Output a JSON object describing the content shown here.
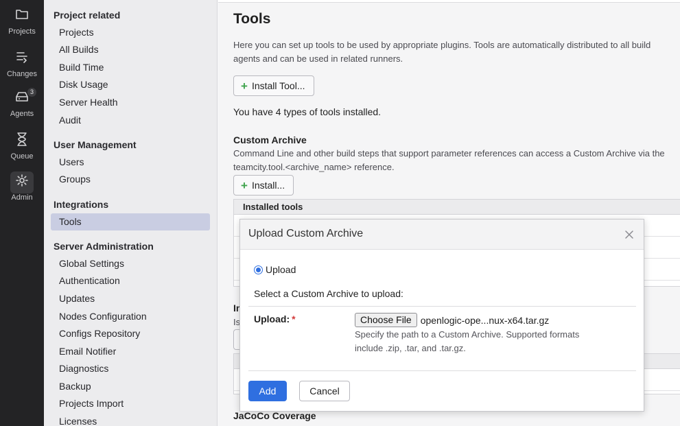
{
  "rail": {
    "items": [
      {
        "label": "Projects",
        "icon": "folder-icon"
      },
      {
        "label": "Changes",
        "icon": "changes-icon"
      },
      {
        "label": "Agents",
        "icon": "agents-icon",
        "badge": "3"
      },
      {
        "label": "Queue",
        "icon": "hourglass-icon"
      },
      {
        "label": "Admin",
        "icon": "gear-icon",
        "active": true
      }
    ]
  },
  "sidebar": {
    "sections": [
      {
        "heading": "Project related",
        "items": [
          "Projects",
          "All Builds",
          "Build Time",
          "Disk Usage",
          "Server Health",
          "Audit"
        ]
      },
      {
        "heading": "User Management",
        "items": [
          "Users",
          "Groups"
        ]
      },
      {
        "heading": "Integrations",
        "items": [
          "Tools"
        ]
      },
      {
        "heading": "Server Administration",
        "items": [
          "Global Settings",
          "Authentication",
          "Updates",
          "Nodes Configuration",
          "Configs Repository",
          "Email Notifier",
          "Diagnostics",
          "Backup",
          "Projects Import",
          "Licenses"
        ]
      }
    ],
    "active_item": "Tools"
  },
  "main": {
    "title": "Tools",
    "description": "Here you can set up tools to be used by appropriate plugins. Tools are automatically distributed to all build agents and can be used in related runners.",
    "install_tool_label": "Install Tool...",
    "installed_count_text": "You have 4 types of tools installed.",
    "custom_archive": {
      "title": "Custom Archive",
      "description": "Command Line and other build steps that support parameter references can access a Custom Archive via the teamcity.tool.<archive_name> reference.",
      "install_label": "Install...",
      "table_header": "Installed tools"
    },
    "partial_section_letters": "In",
    "partial_section_desc": "Is",
    "next_section_title": "JaCoCo Coverage"
  },
  "dialog": {
    "title": "Upload Custom Archive",
    "radio_label": "Upload",
    "select_prompt": "Select a Custom Archive to upload:",
    "upload_label": "Upload:",
    "required_mark": "*",
    "choose_file_label": "Choose File",
    "file_name": "openlogic-ope...nux-x64.tar.gz",
    "hint": "Specify the path to a Custom Archive. Supported formats include .zip, .tar, and .tar.gz.",
    "add_label": "Add",
    "cancel_label": "Cancel"
  }
}
